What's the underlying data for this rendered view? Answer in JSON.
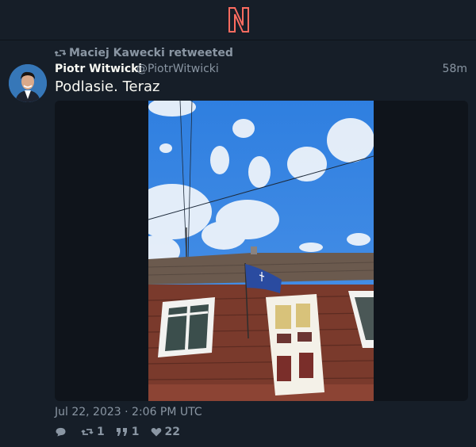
{
  "header": {
    "logo_icon": "nitter-logo-icon",
    "accent": "#ff6c60"
  },
  "tweet": {
    "retweet_text": "Maciej Kawecki retweeted",
    "fullname": "Piotr Witwicki",
    "username": "@PiotrWitwicki",
    "time": "58m",
    "content": "Podlasie. Teraz",
    "date": "Jul 22, 2023 · 2:06 PM UTC",
    "stats": {
      "replies": "",
      "retweets": "1",
      "quotes": "1",
      "likes": "22"
    }
  }
}
